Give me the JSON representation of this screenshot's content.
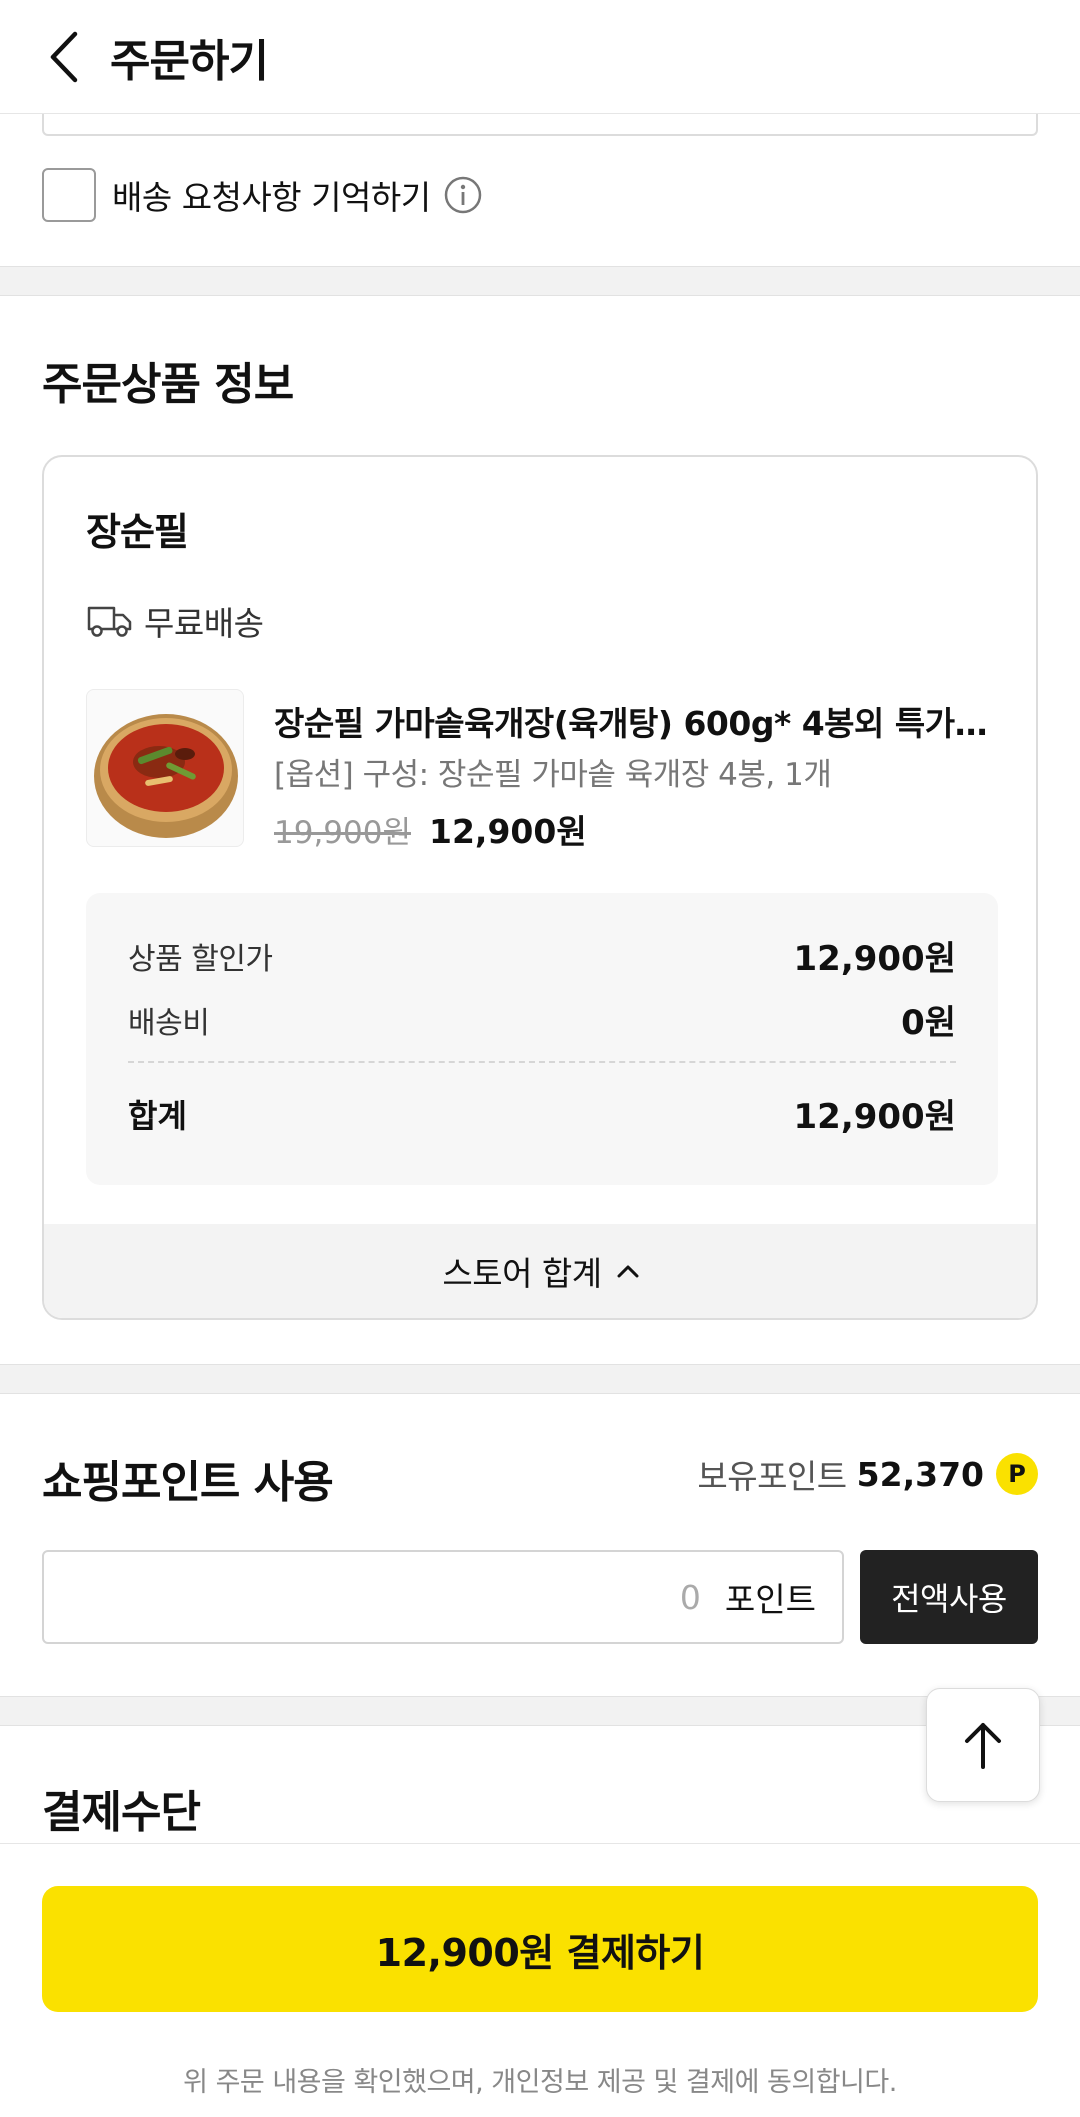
{
  "header": {
    "title": "주문하기"
  },
  "delivery": {
    "remember_label": "배송 요청사항 기억하기"
  },
  "order_items": {
    "section_title": "주문상품 정보",
    "store_name": "장순필",
    "shipping_label": "무료배송",
    "product": {
      "name": "장순필 가마솥육개장(육개탕) 600g* 4봉외 특가상…",
      "option": "[옵션] 구성: 장순필 가마솥 육개장 4봉, 1개",
      "price_original": "19,900원",
      "price_sale": "12,900원"
    },
    "summary": {
      "discount_label": "상품 할인가",
      "discount_value": "12,900원",
      "shipping_fee_label": "배송비",
      "shipping_fee_value": "0원",
      "total_label": "합계",
      "total_value": "12,900원"
    },
    "store_total_label": "스토어 합계"
  },
  "points": {
    "section_title": "쇼핑포인트 사용",
    "held_label": "보유포인트",
    "held_value": "52,370",
    "badge": "P",
    "input_value": "0",
    "unit": "포인트",
    "use_all_label": "전액사용"
  },
  "payment": {
    "section_title": "결제수단"
  },
  "bottom": {
    "pay_button_label": "12,900원 결제하기",
    "agreement_text": "위 주문 내용을 확인했으며, 개인정보 제공 및 결제에 동의합니다."
  },
  "colors": {
    "accent": "#fae100",
    "dark_button": "#222222"
  }
}
